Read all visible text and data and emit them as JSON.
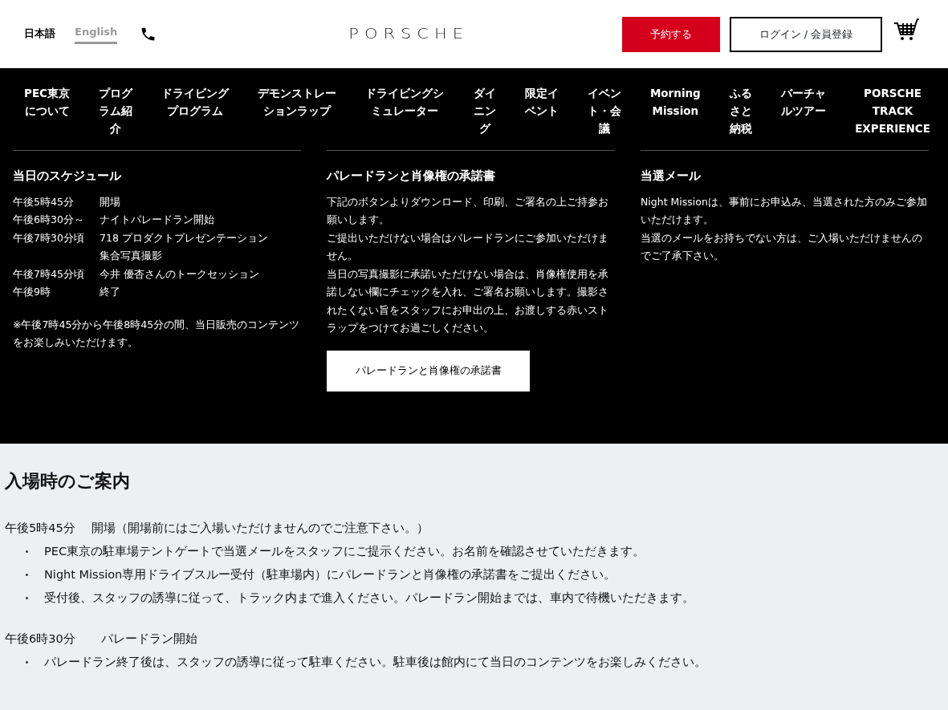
{
  "header": {
    "languages": [
      {
        "label": "日本語",
        "selected": true
      },
      {
        "label": "English",
        "selected": false
      }
    ],
    "logo": "PORSCHE",
    "reserve_button": "予約する",
    "login_button": "ログイン / 会員登録"
  },
  "nav": [
    {
      "lines": [
        "PEC東京",
        "について"
      ]
    },
    {
      "lines": [
        "プログ",
        "ラム紹",
        "介"
      ]
    },
    {
      "lines": [
        "ドライビング",
        "プログラム"
      ]
    },
    {
      "lines": [
        "デモンストレー",
        "ションラップ"
      ]
    },
    {
      "lines": [
        "ドライビングシ",
        "ミュレーター"
      ]
    },
    {
      "lines": [
        "ダイ",
        "ニン",
        "グ"
      ]
    },
    {
      "lines": [
        "限定イ",
        "ベント"
      ]
    },
    {
      "lines": [
        "イベン",
        "ト・会",
        "議"
      ]
    },
    {
      "lines": [
        "Morning",
        "Mission"
      ]
    },
    {
      "lines": [
        "ふる",
        "さと",
        "納税"
      ]
    },
    {
      "lines": [
        "バーチャ",
        "ルツアー"
      ]
    },
    {
      "lines": [
        "PORSCHE",
        "TRACK",
        "EXPERIENCE"
      ]
    }
  ],
  "schedule": {
    "title": "当日のスケジュール",
    "rows": [
      {
        "time": "午後5時45分",
        "event": [
          "開場"
        ]
      },
      {
        "time": "午後6時30分～",
        "event": [
          "ナイトパレードラン開始"
        ]
      },
      {
        "time": "午後7時30分頃",
        "event": [
          "718 プロダクトプレゼンテーション",
          "集合写真撮影"
        ]
      },
      {
        "time": "午後7時45分頃",
        "event": [
          "今井 優杏さんのトークセッション"
        ]
      },
      {
        "time": "午後9時",
        "event": [
          "終了"
        ]
      }
    ],
    "note": "※午後7時45分から午後8時45分の間、当日販売のコンテンツをお楽しみいただけます。"
  },
  "consent": {
    "title": "パレードランと肖像権の承諾書",
    "paragraphs": [
      "下記のボタンよりダウンロード、印刷、ご署名の上ご持参お願いします。",
      "ご提出いただけない場合はパレードランにご参加いただけません。",
      "当日の写真撮影に承諾いただけない場合は、肖像権使用を承諾しない欄にチェックを入れ、ご署名お願いします。撮影されたくない旨をスタッフにお申出の上、お渡しする赤いストラップをつけてお過ごしください。"
    ],
    "button": "パレードランと肖像権の承諾書"
  },
  "mail": {
    "title": "当選メール",
    "paragraphs": [
      "Night Missionは、事前にお申込み、当選された方のみご参加いただけます。",
      "当選のメールをお持ちでない方は、ご入場いただけませんのでご了承下さい。"
    ]
  },
  "guide": {
    "title": "入場時のご案内",
    "sections": [
      {
        "time": "午後5時45分",
        "label": "開場（開場前にはご入場いただけませんのでご注意下さい。）",
        "items": [
          "PEC東京の駐車場テントゲートで当選メールをスタッフにご提示ください。お名前を確認させていただきます。",
          "Night Mission専用ドライブスルー受付（駐車場内）にパレードランと肖像権の承諾書をご提出ください。",
          "受付後、スタッフの誘導に従って、トラック内まで進入ください。パレードラン開始までは、車内で待機いただきます。"
        ]
      },
      {
        "time": "午後6時30分",
        "label": "パレードラン開始",
        "items": [
          "パレードラン終了後は、スタッフの誘導に従って駐車ください。駐車後は館内にて当日のコンテンツをお楽しみください。"
        ]
      }
    ]
  }
}
